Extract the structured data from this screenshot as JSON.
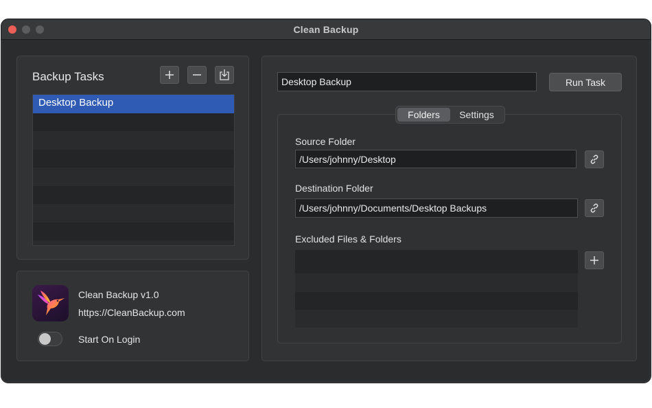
{
  "window": {
    "title": "Clean Backup"
  },
  "tasks": {
    "heading": "Backup Tasks",
    "items": [
      "Desktop Backup"
    ],
    "add_icon": "plus-icon",
    "remove_icon": "minus-icon",
    "import_icon": "import-icon"
  },
  "about": {
    "app_name": "Clean Backup v1.0",
    "url": "https://CleanBackup.com",
    "start_on_login_label": "Start On Login",
    "start_on_login": false
  },
  "detail": {
    "task_name": "Desktop Backup",
    "run_label": "Run Task",
    "tabs": [
      {
        "label": "Folders",
        "active": true
      },
      {
        "label": "Settings",
        "active": false
      }
    ],
    "source_label": "Source Folder",
    "source_value": "/Users/johnny/Desktop",
    "destination_label": "Destination Folder",
    "destination_value": "/Users/johnny/Documents/Desktop Backups",
    "excluded_label": "Excluded Files & Folders",
    "excluded_items": []
  },
  "colors": {
    "selection": "#2f5bb5",
    "close": "#ec5f57",
    "background": "#2b2c2e"
  }
}
